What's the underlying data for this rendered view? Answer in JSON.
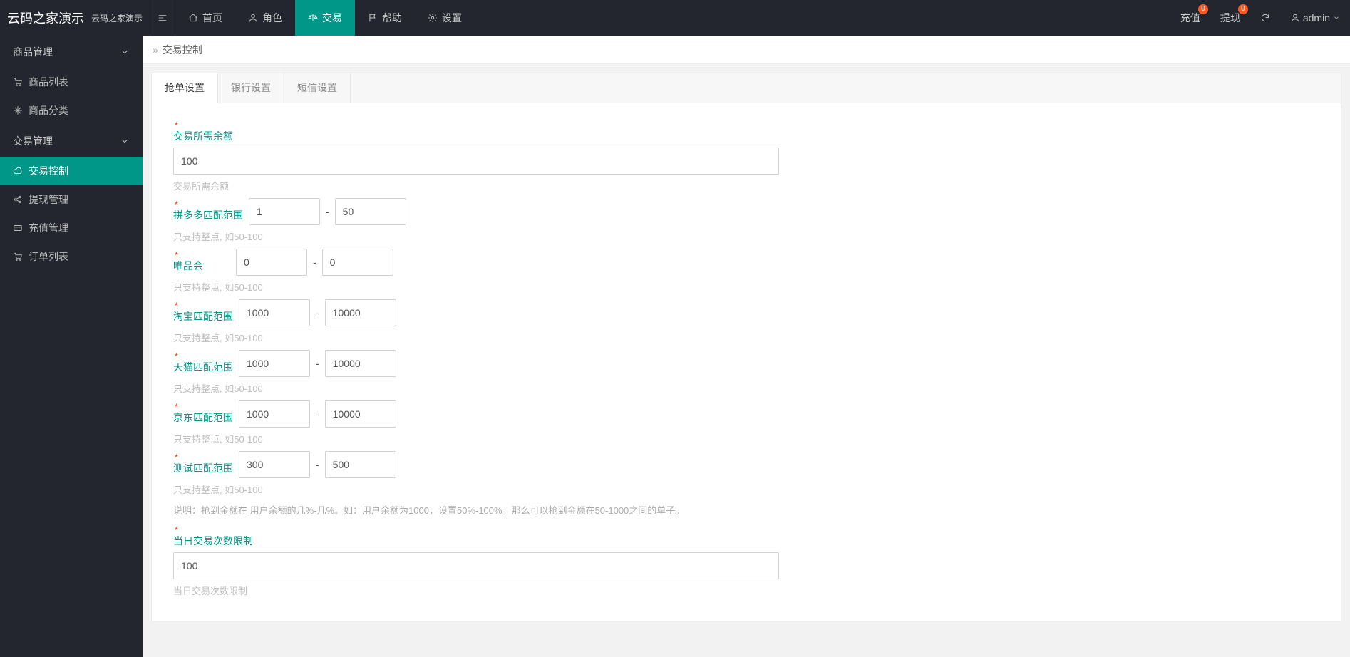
{
  "brand": {
    "main": "云码之家演示",
    "sub": "云码之家演示"
  },
  "topnav": {
    "items": [
      {
        "label": "首页",
        "icon": "home"
      },
      {
        "label": "角色",
        "icon": "user"
      },
      {
        "label": "交易",
        "icon": "scale"
      },
      {
        "label": "帮助",
        "icon": "flag"
      },
      {
        "label": "设置",
        "icon": "gear"
      }
    ]
  },
  "topright": {
    "recharge": {
      "label": "充值",
      "badge": "0"
    },
    "withdraw": {
      "label": "提现",
      "badge": "0"
    },
    "refresh_icon": "refresh",
    "user": {
      "label": "admin"
    }
  },
  "sidebar": {
    "groups": [
      {
        "label": "商品管理",
        "items": [
          {
            "label": "商品列表",
            "icon": "cart"
          },
          {
            "label": "商品分类",
            "icon": "snow"
          }
        ]
      },
      {
        "label": "交易管理",
        "items": [
          {
            "label": "交易控制",
            "icon": "cloud",
            "active": true
          },
          {
            "label": "提现管理",
            "icon": "share"
          },
          {
            "label": "充值管理",
            "icon": "card"
          },
          {
            "label": "订单列表",
            "icon": "cart2"
          }
        ]
      }
    ]
  },
  "breadcrumb": {
    "title": "交易控制"
  },
  "tabs": {
    "items": [
      "抢单设置",
      "银行设置",
      "短信设置"
    ]
  },
  "form": {
    "balance": {
      "label": "交易所需余额",
      "value": "100",
      "hint": "交易所需余额"
    },
    "ranges": [
      {
        "label": "拼多多匹配范围",
        "min": "1",
        "max": "50",
        "hint": "只支持整点, 如50-100"
      },
      {
        "label": "唯品会",
        "min": "0",
        "max": "0",
        "hint": "只支持整点, 如50-100"
      },
      {
        "label": "淘宝匹配范围",
        "min": "1000",
        "max": "10000",
        "hint": "只支持整点, 如50-100"
      },
      {
        "label": "天猫匹配范围",
        "min": "1000",
        "max": "10000",
        "hint": "只支持整点, 如50-100"
      },
      {
        "label": "京东匹配范围",
        "min": "1000",
        "max": "10000",
        "hint": "只支持整点, 如50-100"
      },
      {
        "label": "测试匹配范围",
        "min": "300",
        "max": "500",
        "hint": "只支持整点, 如50-100"
      }
    ],
    "desc": "说明：抢到金额在 用户余额的几%-几%。如：用户余额为1000，设置50%-100%。那么可以抢到金额在50-1000之间的单子。",
    "daily_limit": {
      "label": "当日交易次数限制",
      "value": "100",
      "hint": "当日交易次数限制"
    }
  }
}
